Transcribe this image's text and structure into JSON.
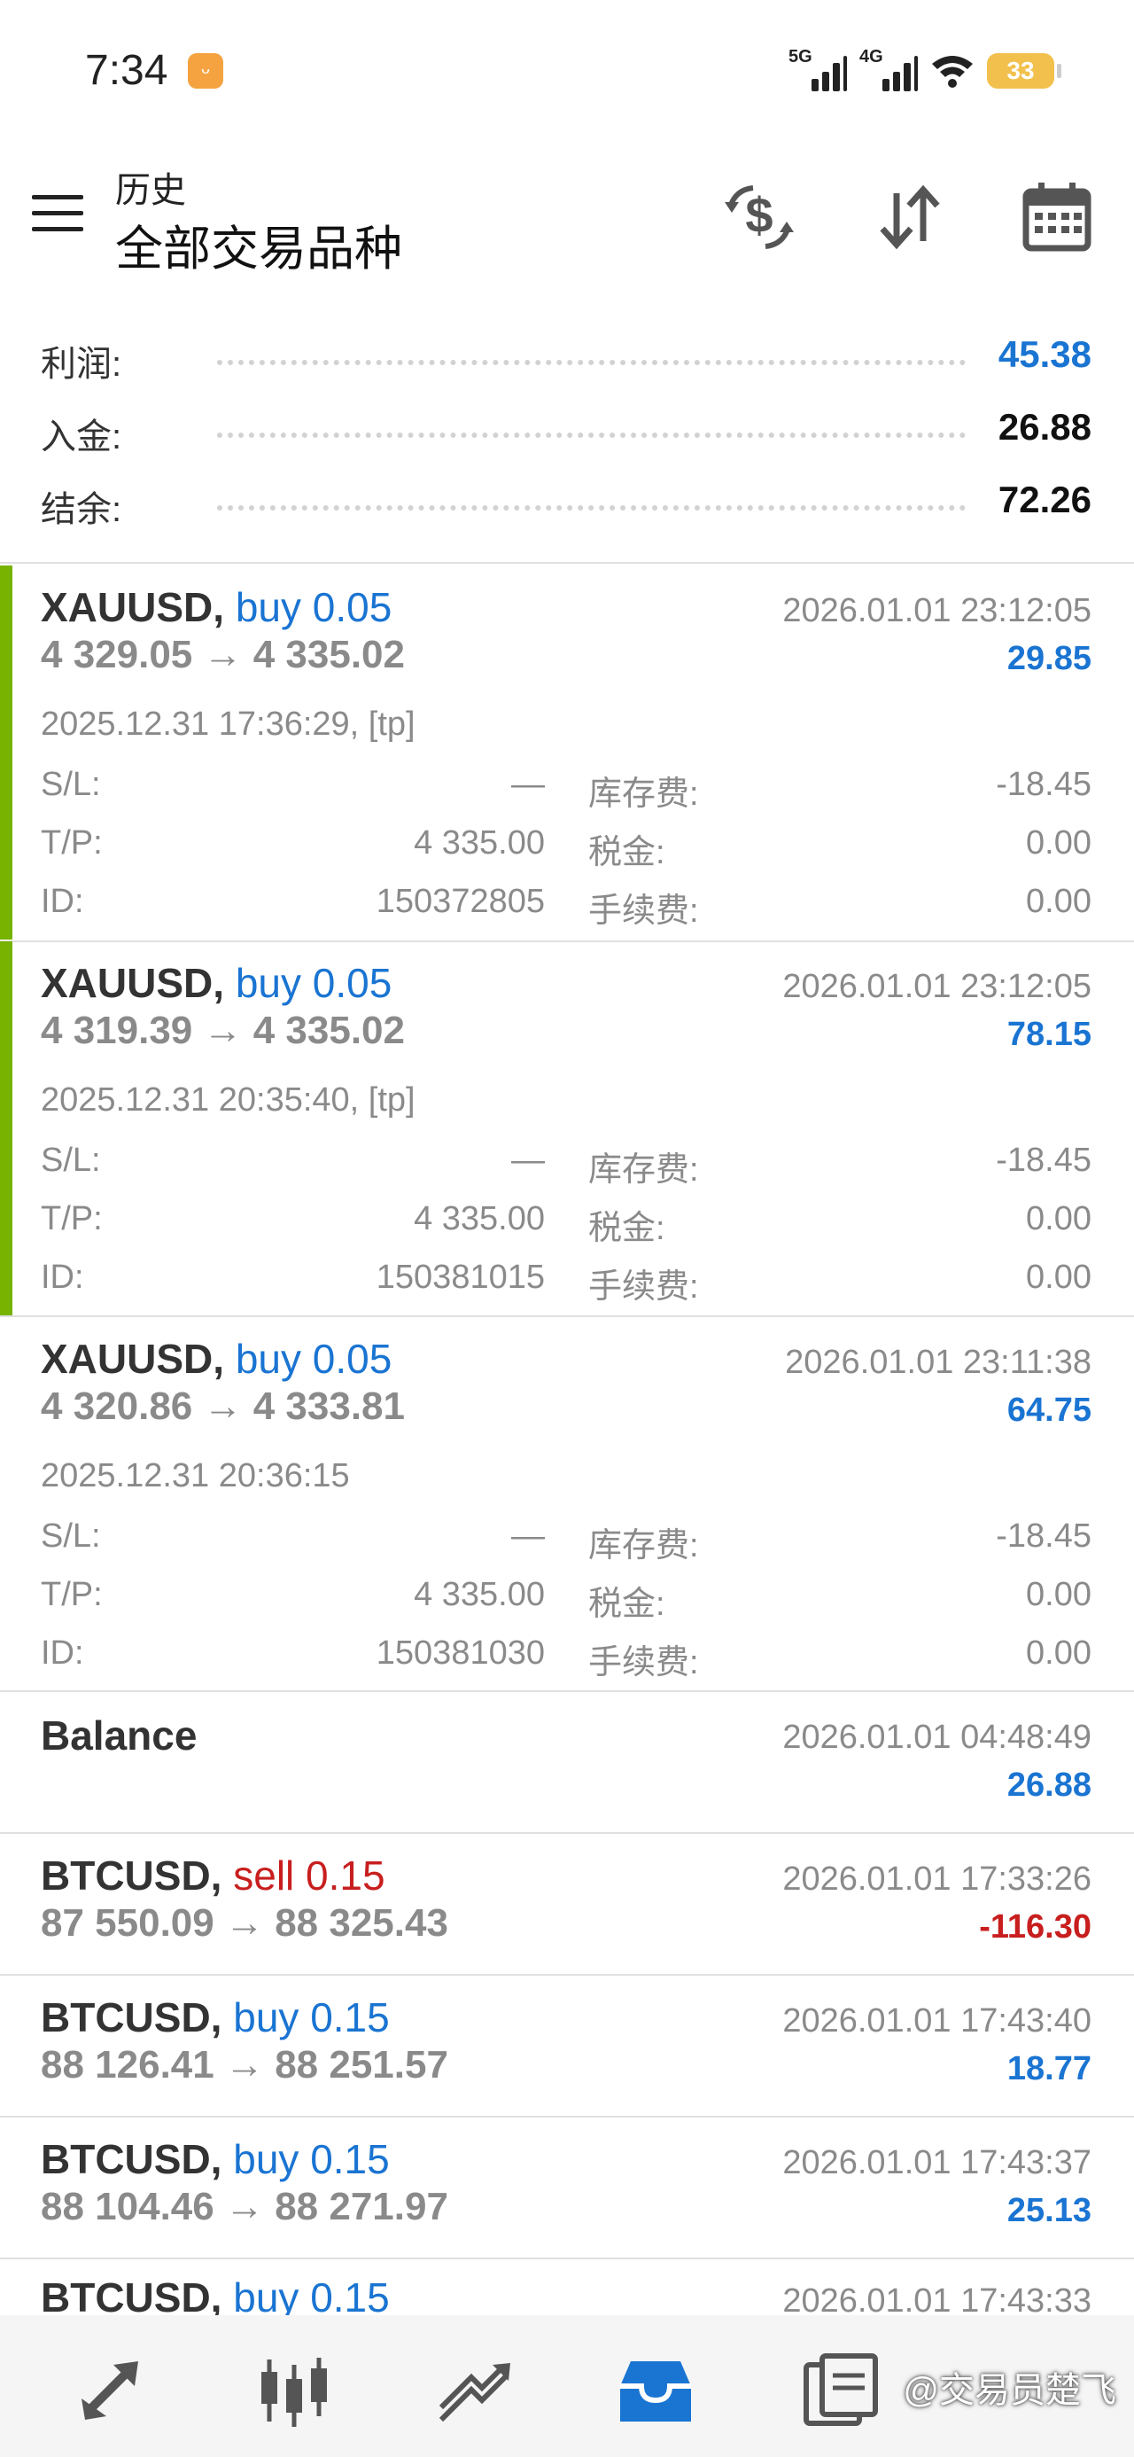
{
  "status_bar": {
    "time": "7:34",
    "net1": "5G",
    "net2": "4G",
    "battery": "33"
  },
  "header": {
    "subtitle": "历史",
    "title": "全部交易品种"
  },
  "summary": [
    {
      "label": "利润:",
      "value": "45.38",
      "highlight": true
    },
    {
      "label": "入金:",
      "value": "26.88",
      "highlight": false
    },
    {
      "label": "结余:",
      "value": "72.26",
      "highlight": false
    }
  ],
  "deals": [
    {
      "symbol": "XAUUSD,",
      "side": "buy",
      "volume": "0.05",
      "prices": "4 329.05 → 4 335.02",
      "close_time": "2026.01.01 23:12:05",
      "profit": "29.85",
      "open_info": "2025.12.31 17:36:29, [tp]",
      "details": [
        {
          "l1": "S/L:",
          "v1": "—",
          "l2": "库存费:",
          "v2": "-18.45"
        },
        {
          "l1": "T/P:",
          "v1": "4 335.00",
          "l2": "税金:",
          "v2": "0.00"
        },
        {
          "l1": "ID:",
          "v1": "150372805",
          "l2": "手续费:",
          "v2": "0.00"
        }
      ]
    },
    {
      "symbol": "XAUUSD,",
      "side": "buy",
      "volume": "0.05",
      "prices": "4 319.39 → 4 335.02",
      "close_time": "2026.01.01 23:12:05",
      "profit": "78.15",
      "open_info": "2025.12.31 20:35:40, [tp]",
      "details": [
        {
          "l1": "S/L:",
          "v1": "—",
          "l2": "库存费:",
          "v2": "-18.45"
        },
        {
          "l1": "T/P:",
          "v1": "4 335.00",
          "l2": "税金:",
          "v2": "0.00"
        },
        {
          "l1": "ID:",
          "v1": "150381015",
          "l2": "手续费:",
          "v2": "0.00"
        }
      ]
    },
    {
      "symbol": "XAUUSD,",
      "side": "buy",
      "volume": "0.05",
      "prices": "4 320.86 → 4 333.81",
      "close_time": "2026.01.01 23:11:38",
      "profit": "64.75",
      "open_info": "2025.12.31 20:36:15",
      "details": [
        {
          "l1": "S/L:",
          "v1": "—",
          "l2": "库存费:",
          "v2": "-18.45"
        },
        {
          "l1": "T/P:",
          "v1": "4 335.00",
          "l2": "税金:",
          "v2": "0.00"
        },
        {
          "l1": "ID:",
          "v1": "150381030",
          "l2": "手续费:",
          "v2": "0.00"
        }
      ]
    },
    {
      "symbol": "Balance",
      "close_time": "2026.01.01 04:48:49",
      "profit": "26.88"
    },
    {
      "symbol": "BTCUSD,",
      "side": "sell",
      "volume": "0.15",
      "prices": "87 550.09 → 88 325.43",
      "close_time": "2026.01.01 17:33:26",
      "profit": "-116.30"
    },
    {
      "symbol": "BTCUSD,",
      "side": "buy",
      "volume": "0.15",
      "prices": "88 126.41 → 88 251.57",
      "close_time": "2026.01.01 17:43:40",
      "profit": "18.77"
    },
    {
      "symbol": "BTCUSD,",
      "side": "buy",
      "volume": "0.15",
      "prices": "88 104.46 → 88 271.97",
      "close_time": "2026.01.01 17:43:37",
      "profit": "25.13"
    },
    {
      "symbol": "BTCUSD,",
      "side": "buy",
      "volume": "0.15",
      "close_time": "2026.01.01 17:43:33"
    }
  ],
  "bottom_nav": [
    "quotes-icon",
    "chart-candles-icon",
    "trade-icon",
    "history-icon",
    "messages-icon"
  ],
  "watermark": "@交易员楚飞",
  "colors": {
    "accent_green": "#77b300",
    "buy_blue": "#1a74d2",
    "sell_red": "#c81e1e"
  }
}
